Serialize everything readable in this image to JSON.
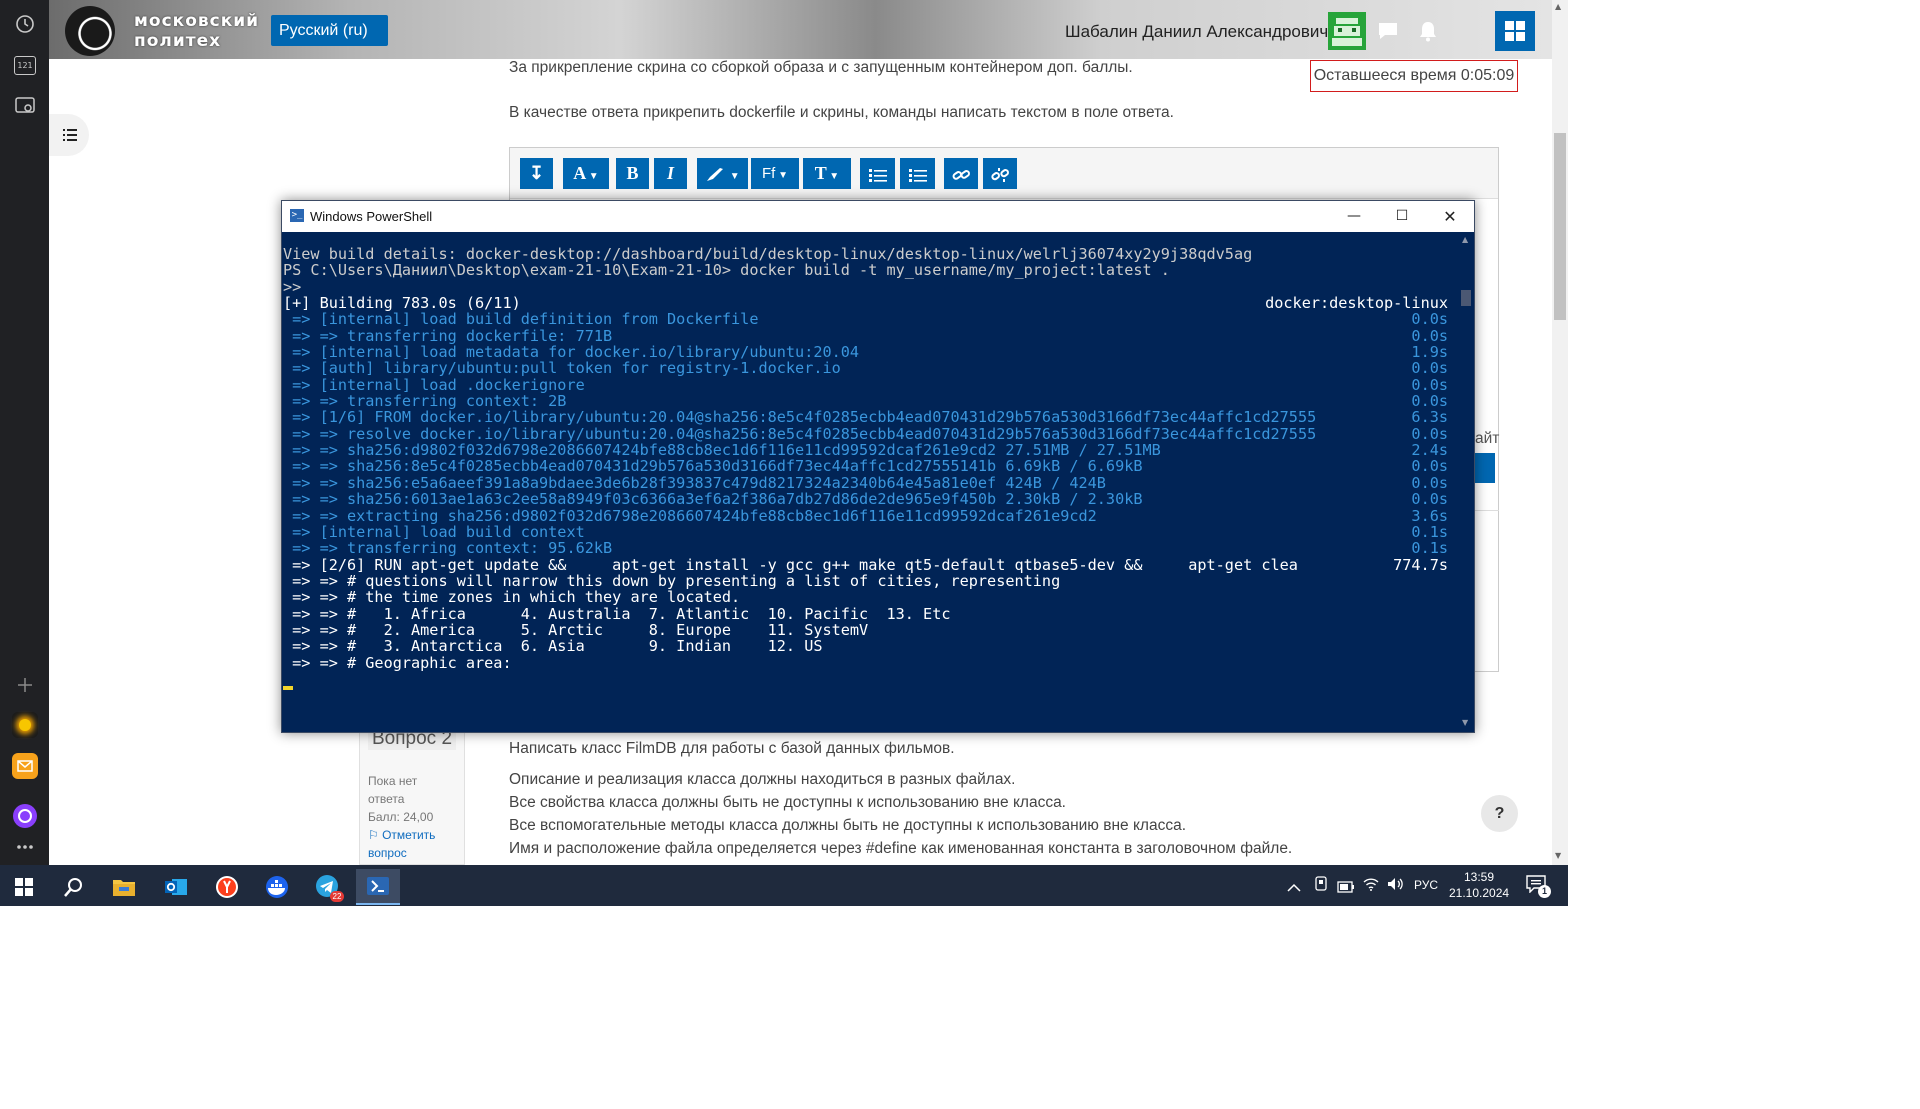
{
  "header": {
    "logo_line1": "московский",
    "logo_line2": "политех",
    "language": "Русский (ru)",
    "user_name": "Шабалин Даниил Александрович"
  },
  "timer": "Оставшееся время 0:05:09",
  "question1": {
    "line_bonus": "За прикрепление скрина со сборкой образа и с запущенным контейнером доп. баллы.",
    "line_answer": "В качестве ответа прикрепить dockerfile и скрины, команды написать текстом в поле ответа.",
    "partial_text": "айт"
  },
  "question2": {
    "label": "Вопрос 2",
    "status_1": "Пока нет",
    "status_2": "ответа",
    "score": "Балл: 24,00",
    "flag_1": "Отметить",
    "flag_2": "вопрос",
    "lines": [
      "Написать класс FilmDB для работы с базой данных фильмов.",
      "Описание и реализация класса должны находиться в разных файлах.",
      "Все свойства класса должны быть не доступны к использованию вне класса.",
      "Все вспомогательные методы класса должны быть не доступны к использованию вне класса.",
      "Имя и расположение файла определяется через #define как именованная константа в заголовочном файле."
    ]
  },
  "help_label": "?",
  "toolbar": {
    "bold": "B",
    "italic": "I",
    "font_a": "A",
    "font_ff": "Ff",
    "font_t": "T"
  },
  "sidebar": {
    "counter_badge": "121"
  },
  "powershell": {
    "title": "Windows PowerShell",
    "lines": [
      {
        "text": "View build details: docker-desktop://dashboard/build/desktop-linux/desktop-linux/welrlj36074xy2y9j38qdv5ag",
        "right": "",
        "color": "gray"
      },
      {
        "text": "PS C:\\Users\\Даниил\\Desktop\\exam-21-10\\Exam-21-10> docker build -t my_username/my_project:latest .",
        "right": "",
        "color": "gray"
      },
      {
        "text": ">>",
        "right": "",
        "color": "gray"
      },
      {
        "text": "[+] Building 783.0s (6/11)",
        "right": "docker:desktop-linux",
        "color": "white"
      },
      {
        "text": " => [internal] load build definition from Dockerfile",
        "right": "0.0s",
        "color": "blue"
      },
      {
        "text": " => => transferring dockerfile: 771B",
        "right": "0.0s",
        "color": "blue"
      },
      {
        "text": " => [internal] load metadata for docker.io/library/ubuntu:20.04",
        "right": "1.9s",
        "color": "blue"
      },
      {
        "text": " => [auth] library/ubuntu:pull token for registry-1.docker.io",
        "right": "0.0s",
        "color": "blue"
      },
      {
        "text": " => [internal] load .dockerignore",
        "right": "0.0s",
        "color": "blue"
      },
      {
        "text": " => => transferring context: 2B",
        "right": "0.0s",
        "color": "blue"
      },
      {
        "text": " => [1/6] FROM docker.io/library/ubuntu:20.04@sha256:8e5c4f0285ecbb4ead070431d29b576a530d3166df73ec44affc1cd27555",
        "right": "6.3s",
        "color": "blue"
      },
      {
        "text": " => => resolve docker.io/library/ubuntu:20.04@sha256:8e5c4f0285ecbb4ead070431d29b576a530d3166df73ec44affc1cd27555",
        "right": "0.0s",
        "color": "blue"
      },
      {
        "text": " => => sha256:d9802f032d6798e2086607424bfe88cb8ec1d6f116e11cd99592dcaf261e9cd2 27.51MB / 27.51MB",
        "right": "2.4s",
        "color": "blue"
      },
      {
        "text": " => => sha256:8e5c4f0285ecbb4ead070431d29b576a530d3166df73ec44affc1cd27555141b 6.69kB / 6.69kB",
        "right": "0.0s",
        "color": "blue"
      },
      {
        "text": " => => sha256:e5a6aeef391a8a9bdaee3de6b28f393837c479d8217324a2340b64e45a81e0ef 424B / 424B",
        "right": "0.0s",
        "color": "blue"
      },
      {
        "text": " => => sha256:6013ae1a63c2ee58a8949f03c6366a3ef6a2f386a7db27d86de2de965e9f450b 2.30kB / 2.30kB",
        "right": "0.0s",
        "color": "blue"
      },
      {
        "text": " => => extracting sha256:d9802f032d6798e2086607424bfe88cb8ec1d6f116e11cd99592dcaf261e9cd2",
        "right": "3.6s",
        "color": "blue"
      },
      {
        "text": " => [internal] load build context",
        "right": "0.1s",
        "color": "blue"
      },
      {
        "text": " => => transferring context: 95.62kB",
        "right": "0.1s",
        "color": "blue"
      },
      {
        "text": " => [2/6] RUN apt-get update &&     apt-get install -y gcc g++ make qt5-default qtbase5-dev &&     apt-get clea",
        "right": "774.7s",
        "color": "white"
      },
      {
        "text": " => => # questions will narrow this down by presenting a list of cities, representing",
        "right": "",
        "color": "white"
      },
      {
        "text": " => => # the time zones in which they are located.",
        "right": "",
        "color": "white"
      },
      {
        "text": " => => #   1. Africa      4. Australia  7. Atlantic  10. Pacific  13. Etc",
        "right": "",
        "color": "white"
      },
      {
        "text": " => => #   2. America     5. Arctic     8. Europe    11. SystemV",
        "right": "",
        "color": "white"
      },
      {
        "text": " => => #   3. Antarctica  6. Asia       9. Indian    12. US",
        "right": "",
        "color": "white"
      },
      {
        "text": " => => # Geographic area:",
        "right": "",
        "color": "white"
      }
    ]
  },
  "taskbar": {
    "telegram_badge": "22",
    "language": "РУС",
    "time": "13:59",
    "date": "21.10.2024",
    "notif_count": "1"
  }
}
